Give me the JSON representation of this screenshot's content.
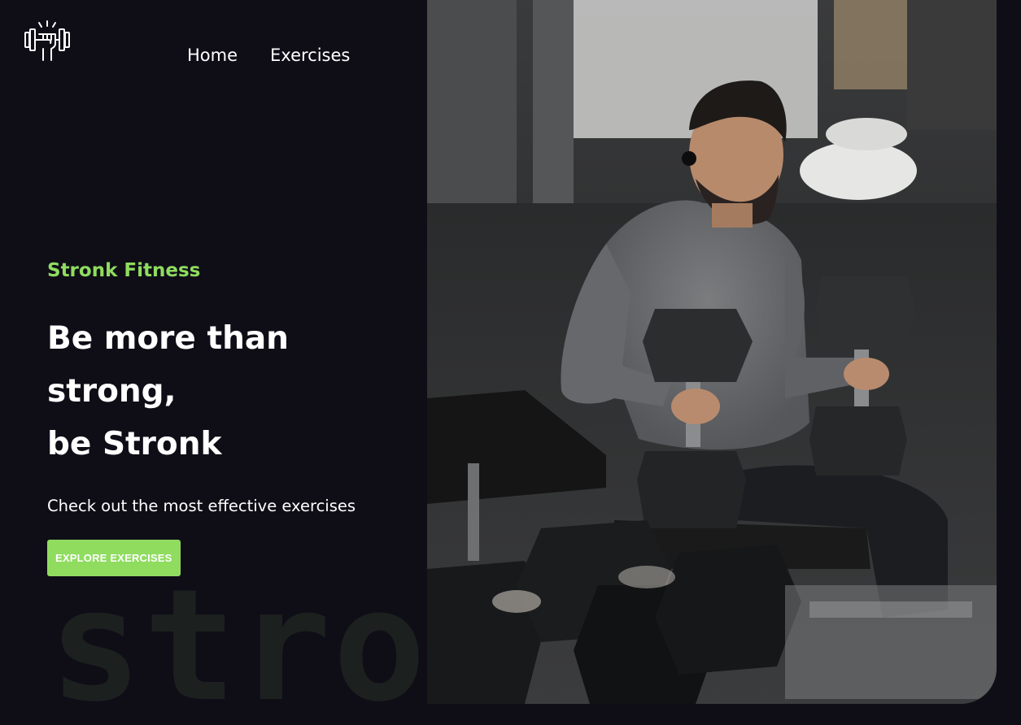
{
  "header": {
    "logo_icon": "dumbbell-fist-icon",
    "nav": [
      {
        "label": "Home"
      },
      {
        "label": "Exercises"
      }
    ]
  },
  "hero": {
    "brand": "Stronk Fitness",
    "headline_line1": "Be more than strong,",
    "headline_line2": "be Stronk",
    "subtext": "Check out the most effective exercises",
    "cta_label": "EXPLORE EXERCISES",
    "watermark": "stronk",
    "image_icon": "man-lifting-dumbbells-photo"
  },
  "colors": {
    "background": "#0f0e17",
    "accent": "#8fdc5f",
    "text": "#ffffff",
    "watermark": "#1c2120"
  }
}
